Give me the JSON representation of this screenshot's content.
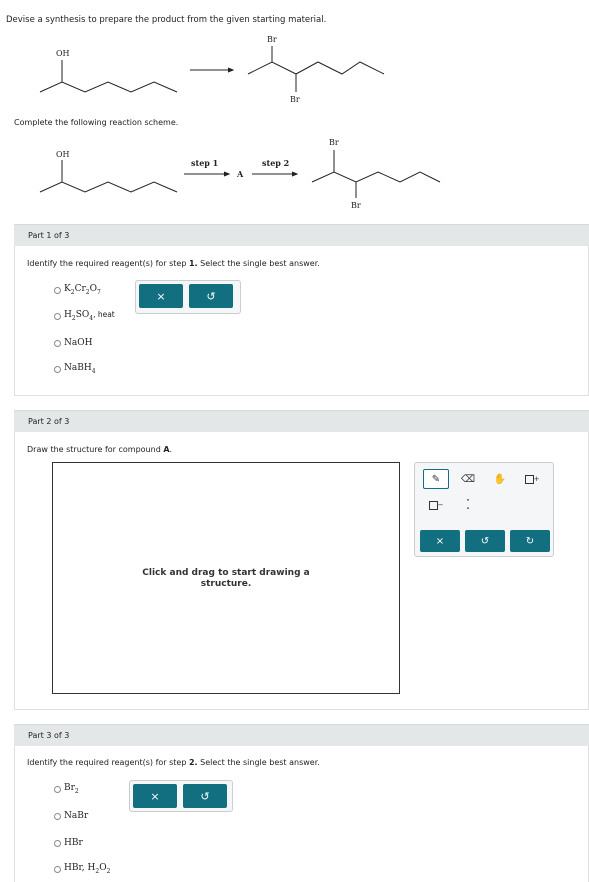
{
  "question": {
    "prompt": "Devise a synthesis to prepare the product from the given starting material.",
    "scheme_prompt": "Complete the following reaction scheme.",
    "labels": {
      "oh": "OH",
      "br": "Br",
      "step1": "step 1",
      "step2": "step 2",
      "intermediate": "A"
    }
  },
  "part1": {
    "label": "Part 1 of 3",
    "instruction_pre": "Identify the required reagent(s) for step ",
    "instruction_step": "1.",
    "instruction_post": " Select the single best answer.",
    "options": {
      "k2cr2o7": {
        "main": "K",
        "s1": "2",
        "m2": "Cr",
        "s2": "2",
        "m3": "O",
        "s3": "7"
      },
      "h2so4": {
        "main": "H",
        "s1": "2",
        "m2": "SO",
        "s2": "4",
        "extra": ", heat"
      },
      "naoh": {
        "main": "NaOH"
      },
      "nabh4": {
        "main": "NaBH",
        "s1": "4"
      }
    },
    "buttons": {
      "clear": "×",
      "undo": "↺"
    }
  },
  "part2": {
    "label": "Part 2 of 3",
    "instruction_pre": "Draw the structure for compound ",
    "instruction_bold": "A",
    "instruction_post": ".",
    "canvas_line1": "Click and drag to start drawing a",
    "canvas_line2": "structure.",
    "tools": {
      "pencil": "✎",
      "eraser": "⌫",
      "hand": "✋",
      "charge_plus": "+",
      "charge_minus": "−",
      "lone_pair": "⁚"
    },
    "buttons": {
      "clear": "×",
      "undo": "↺",
      "redo": "↻"
    }
  },
  "part3": {
    "label": "Part 3 of 3",
    "instruction_pre": "Identify the required reagent(s) for step ",
    "instruction_step": "2.",
    "instruction_post": " Select the single best answer.",
    "options": {
      "br2": {
        "main": "Br",
        "s1": "2"
      },
      "nabr": {
        "main": "NaBr"
      },
      "hbr": {
        "main": "HBr"
      },
      "hbr_h2o2": {
        "main": "HBr, H",
        "s1": "2",
        "m2": "O",
        "s2": "2"
      }
    },
    "buttons": {
      "clear": "×",
      "undo": "↺"
    }
  },
  "colors": {
    "accent": "#126f80",
    "bar": "#e4e7e8"
  }
}
